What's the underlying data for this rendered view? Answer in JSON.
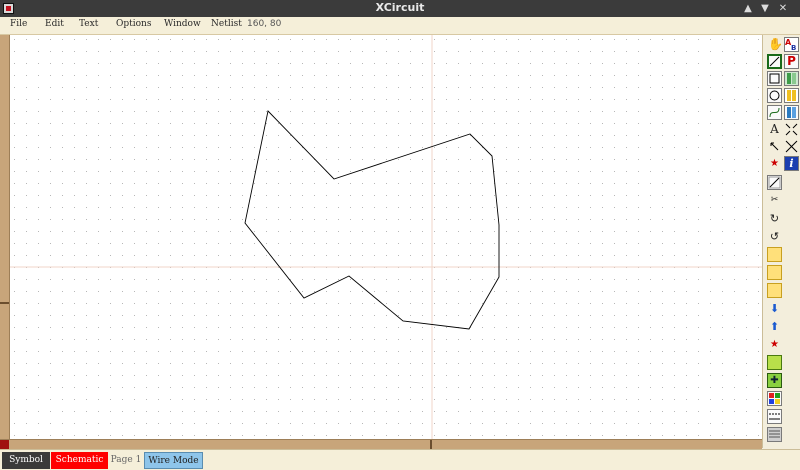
{
  "window": {
    "title": "XCircuit"
  },
  "menu": [
    "File",
    "Edit",
    "Text",
    "Options",
    "Window",
    "Netlist"
  ],
  "coords": "160, 80",
  "status": {
    "symbol": "Symbol",
    "schematic": "Schematic",
    "page": "Page 1",
    "mode": "Wire Mode"
  },
  "colors": {
    "schematic": "#ff0000",
    "symbol": "#3a3a3a",
    "wire_mode": "#8ec5ea"
  },
  "tools": [
    "pan-hand-icon",
    "text-ab-icon",
    "wire-icon",
    "pin-label-icon",
    "box-icon",
    "library-icon",
    "arc-icon",
    "page-directory-icon",
    "spline-icon",
    "book-icon",
    "text-icon",
    "zoom-expand-icon",
    "select-icon",
    "zoom-fit-icon",
    "push-icon",
    "info-icon",
    "edit-icon",
    "cut-icon",
    "rotate-cw-icon",
    "rotate-ccw-icon",
    "flip-h-icon",
    "flip-v-icon",
    "copy-icon",
    "lower-icon",
    "raise-icon",
    "make-object-icon",
    "fill-pattern-icon",
    "puzzle-icon",
    "color-icon",
    "line-style-icon",
    "grid-pattern-icon"
  ]
}
